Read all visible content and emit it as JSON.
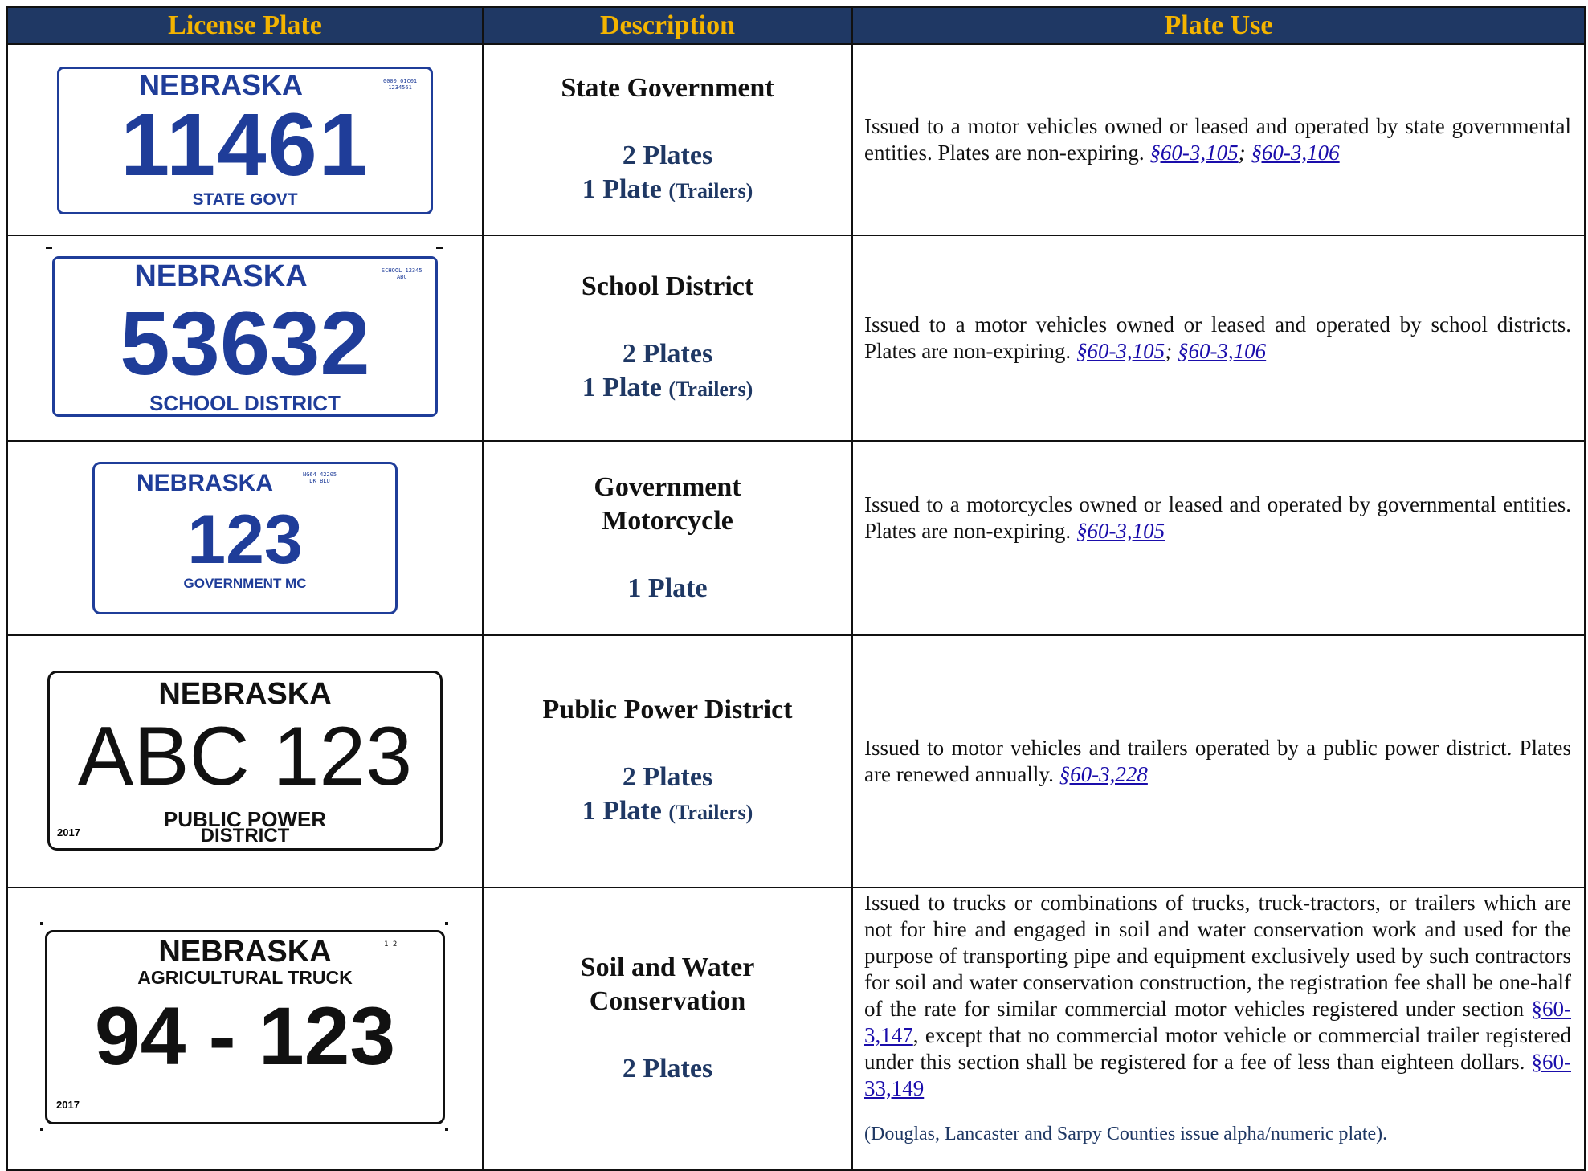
{
  "headers": {
    "plate": "License Plate",
    "description": "Description",
    "use": "Plate Use"
  },
  "colors": {
    "header_bg": "#1f3864",
    "header_text": "#f4b400",
    "plate_blue": "#1f3d99",
    "link": "#1a0dab"
  },
  "rows": [
    {
      "plate": {
        "state": "NEBRASKA",
        "number": "11461",
        "type": "STATE GOVT",
        "code_line1": "0000 01C01",
        "code_line2": "1234561"
      },
      "desc": {
        "title": "State Government",
        "plates": "2 Plates",
        "trailer_plate": "1 Plate",
        "trailer_note": "(Trailers)"
      },
      "use": {
        "text": "Issued to a motor vehicles owned or leased and operated by state governmental entities. Plates are non-expiring. ",
        "link1": "§60-3,105",
        "sep": "; ",
        "link2": "§60-3,106"
      }
    },
    {
      "plate": {
        "state": "NEBRASKA",
        "number": "53632",
        "type": "SCHOOL DISTRICT",
        "code_line1": "SCHOOL 12345",
        "code_line2": "ABC"
      },
      "desc": {
        "title": "School District",
        "plates": "2 Plates",
        "trailer_plate": "1 Plate",
        "trailer_note": "(Trailers)"
      },
      "use": {
        "text": "Issued to a motor vehicles owned or leased and operated by school districts. Plates are non-expiring. ",
        "link1": "§60-3,105",
        "sep": "; ",
        "link2": "§60-3,106"
      }
    },
    {
      "plate": {
        "state": "NEBRASKA",
        "number": "123",
        "type": "GOVERNMENT MC",
        "code_line1": "NG64  42205",
        "code_line2": "DK BLU"
      },
      "desc": {
        "title_line1": "Government",
        "title_line2": "Motorcycle",
        "plates": "1 Plate"
      },
      "use": {
        "text": "Issued to a motorcycles owned or leased and operated by governmental entities. Plates are non-expiring. ",
        "link1": "§60-3,105"
      }
    },
    {
      "plate": {
        "state": "NEBRASKA",
        "number": "ABC 123",
        "type_line1": "PUBLIC POWER",
        "type_line2": "DISTRICT",
        "year": "2017"
      },
      "desc": {
        "title": "Public Power District",
        "plates": "2 Plates",
        "trailer_plate": "1 Plate",
        "trailer_note": "(Trailers)"
      },
      "use": {
        "text": "Issued to motor vehicles and trailers operated by a public power district. Plates are renewed annually. ",
        "link1": "§60-3,228"
      }
    },
    {
      "plate": {
        "state": "NEBRASKA",
        "subtitle": "AGRICULTURAL TRUCK",
        "number": "94 - 123",
        "year": "2017",
        "marks": "1  2"
      },
      "desc": {
        "title_line1": "Soil and Water",
        "title_line2": "Conservation",
        "plates": "2 Plates"
      },
      "use": {
        "text_before": "Issued to trucks or combinations of trucks, truck-tractors, or trailers which are not for hire and engaged in soil and water conservation work and used for the purpose of transporting pipe and equipment exclusively used by such contractors for soil and water conservation construction, the registration fee shall be one-half of the rate for similar commercial motor vehicles registered under section ",
        "link1": "§60-3,147",
        "text_middle": ", except that no commercial motor vehicle or commercial trailer registered under this section shall be registered for a fee of less than eighteen dollars. ",
        "link2": "§60-33,149",
        "note": "(Douglas, Lancaster and Sarpy Counties issue alpha/numeric plate)."
      }
    }
  ]
}
